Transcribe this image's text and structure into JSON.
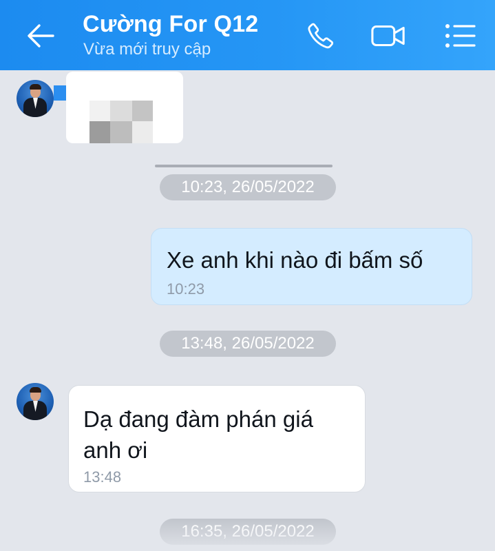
{
  "header": {
    "contact_name": "Cường For Q12",
    "status": "Vừa mới truy cập",
    "icons": {
      "back": "arrow-left-icon",
      "call": "phone-icon",
      "video": "video-camera-icon",
      "menu": "list-menu-icon"
    },
    "colors": {
      "bar": "#2596f5",
      "text": "#ffffff"
    }
  },
  "conversation": {
    "timestamps": [
      "10:23, 26/05/2022",
      "13:48, 26/05/2022",
      "16:35, 26/05/2022"
    ],
    "messages": [
      {
        "direction": "incoming",
        "type": "image",
        "content": "",
        "time": ""
      },
      {
        "direction": "outgoing",
        "type": "text",
        "content": "Xe anh khi nào đi bấm số",
        "time": "10:23"
      },
      {
        "direction": "incoming",
        "type": "text",
        "content": "Dạ đang đàm phán giá anh ơi",
        "time": "13:48"
      }
    ],
    "colors": {
      "background": "#e3e6ec",
      "outgoing_bubble": "#d4ecff",
      "incoming_bubble": "#ffffff",
      "timestamp_pill": "#c2c6cd"
    }
  }
}
